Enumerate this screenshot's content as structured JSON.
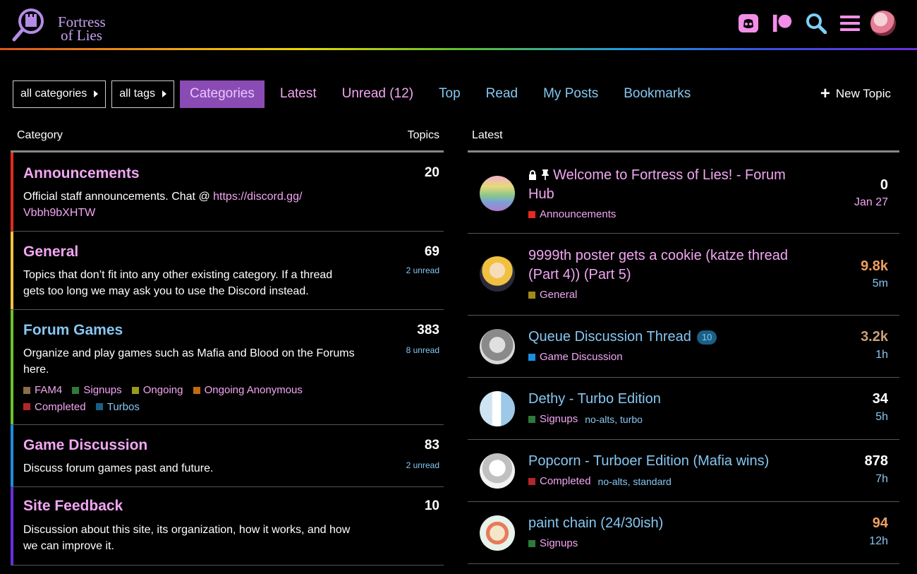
{
  "header": {
    "logo_line1": "Fortress",
    "logo_line2": "of Lies",
    "icons": [
      "discord-icon",
      "patreon-icon",
      "search-icon",
      "hamburger-menu-icon",
      "user-avatar"
    ],
    "accent": "#f28ee8"
  },
  "nav": {
    "all_categories": "all categories",
    "all_tags": "all tags",
    "items": [
      "Categories",
      "Latest",
      "Unread (12)",
      "Top",
      "Read",
      "My Posts",
      "Bookmarks"
    ],
    "new_topic": "New Topic"
  },
  "categories": {
    "col_category": "Category",
    "col_topics": "Topics",
    "list": [
      {
        "name": "Announcements",
        "desc_prefix": "Official staff announcements. Chat @ ",
        "desc_link": "https://discord.gg/",
        "desc_link2": "Vbbh9bXHTW",
        "count": "20",
        "unread": "",
        "color": "#e32b1e"
      },
      {
        "name": "General",
        "desc": "Topics that don’t fit into any other existing category. If a thread gets too long we may ask you to use the Discord instead.",
        "count": "69",
        "unread": "2 unread",
        "color": "#f6c23e"
      },
      {
        "name": "Forum Games",
        "desc": "Organize and play games such as Mafia and Blood on the Forums here.",
        "count": "383",
        "unread": "8 unread",
        "color": "#6ec22a",
        "subcategories": [
          {
            "name": "FAM4",
            "color": "#8a6d4a"
          },
          {
            "name": "Signups",
            "color": "#2f7a3a"
          },
          {
            "name": "Ongoing",
            "color": "#9a9a1a"
          },
          {
            "name": "Ongoing Anonymous",
            "color": "#c46a10"
          },
          {
            "name": "Completed",
            "color": "#b3262b"
          },
          {
            "name": "Turbos",
            "color": "#1a5f86"
          }
        ]
      },
      {
        "name": "Game Discussion",
        "desc": "Discuss forum games past and future.",
        "count": "83",
        "unread": "2 unread",
        "color": "#1b8ee0"
      },
      {
        "name": "Site Feedback",
        "desc": "Discussion about this site, its organization, how it works, and how we can improve it.",
        "count": "10",
        "unread": "",
        "color": "#6a2ee0"
      }
    ]
  },
  "latest": {
    "heading": "Latest",
    "topics": [
      {
        "title": "Welcome to Fortress of Lies! - Forum Hub",
        "category": "Announcements",
        "cat_color": "#e32b1e",
        "tags": "",
        "posts": "0",
        "age": "Jan 27",
        "badge": "",
        "posts_color": "#ffffff",
        "title_color": "#f2a6f2",
        "icons": [
          "lock-icon",
          "pin-icon"
        ]
      },
      {
        "title": "9999th poster gets a cookie (katze thread (Part 4)) (Part 5)",
        "category": "General",
        "cat_color": "#a08a1a",
        "tags": "",
        "posts": "9.8k",
        "age": "5m",
        "badge": "",
        "posts_color": "#f0a060",
        "title_color": "#f2a6f2"
      },
      {
        "title": "Queue Discussion Thread",
        "category": "Game Discussion",
        "cat_color": "#1b8ee0",
        "tags": "",
        "posts": "3.2k",
        "age": "1h",
        "badge": "10",
        "posts_color": "#c8a078",
        "title_color": "#86c7f2"
      },
      {
        "title": "Dethy - Turbo Edition",
        "category": "Signups",
        "cat_color": "#2f7a3a",
        "tags": "no-alts, turbo",
        "posts": "34",
        "age": "5h",
        "badge": "",
        "posts_color": "#ffffff",
        "title_color": "#86c7f2"
      },
      {
        "title": "Popcorn - Turboer Edition (Mafia wins)",
        "category": "Completed",
        "cat_color": "#b3262b",
        "tags": "no-alts, standard",
        "posts": "878",
        "age": "7h",
        "badge": "",
        "posts_color": "#ffffff",
        "title_color": "#86c7f2"
      },
      {
        "title": "paint chain (24/30ish)",
        "category": "Signups",
        "cat_color": "#2f7a3a",
        "tags": "",
        "posts": "94",
        "age": "12h",
        "badge": "",
        "posts_color": "#f0a060",
        "title_color": "#86c7f2"
      }
    ]
  }
}
